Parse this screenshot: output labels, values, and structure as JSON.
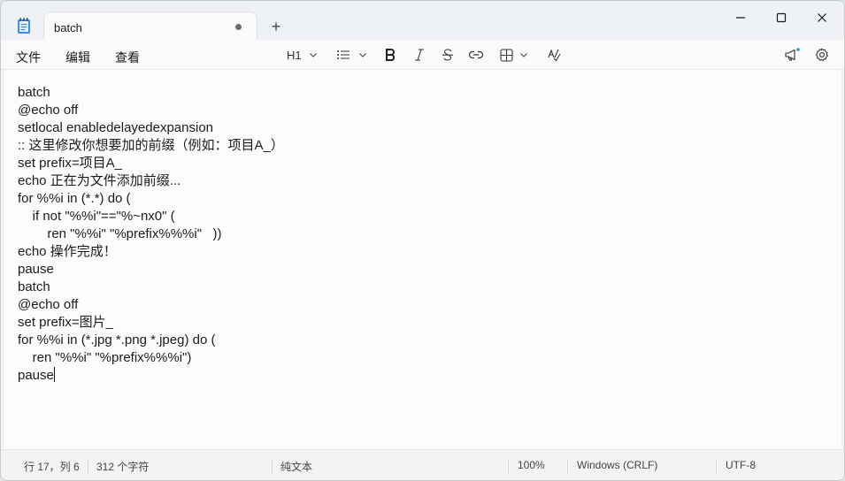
{
  "tab": {
    "title": "batch",
    "new_tab_symbol": "+"
  },
  "menu": {
    "file": "文件",
    "edit": "编辑",
    "view": "查看"
  },
  "toolbar": {
    "heading": "H1",
    "icons": [
      "list-icon",
      "bold-icon",
      "italic-icon",
      "strikethrough-icon",
      "link-icon",
      "table-icon",
      "spellcheck-icon",
      "announcement-icon",
      "settings-icon"
    ]
  },
  "editor": {
    "lines": [
      "batch",
      "@echo off",
      "setlocal enabledelayedexpansion",
      ":: 这里修改你想要加的前缀（例如：项目A_）",
      "set prefix=项目A_",
      "echo 正在为文件添加前缀...",
      "for %%i in (*.*) do (",
      "    if not \"%%i\"==\"%~nx0\" (",
      "        ren \"%%i\" \"%prefix%%%i\"   ))",
      "echo 操作完成！",
      "pause",
      "batch",
      "@echo off",
      "set prefix=图片_",
      "for %%i in (*.jpg *.png *.jpeg) do (",
      "    ren \"%%i\" \"%prefix%%%i\")",
      "pause"
    ]
  },
  "status": {
    "position": "行 17，列 6",
    "char_count": "312 个字符",
    "format": "纯文本",
    "zoom": "100%",
    "line_ending": "Windows (CRLF)",
    "encoding": "UTF-8"
  }
}
